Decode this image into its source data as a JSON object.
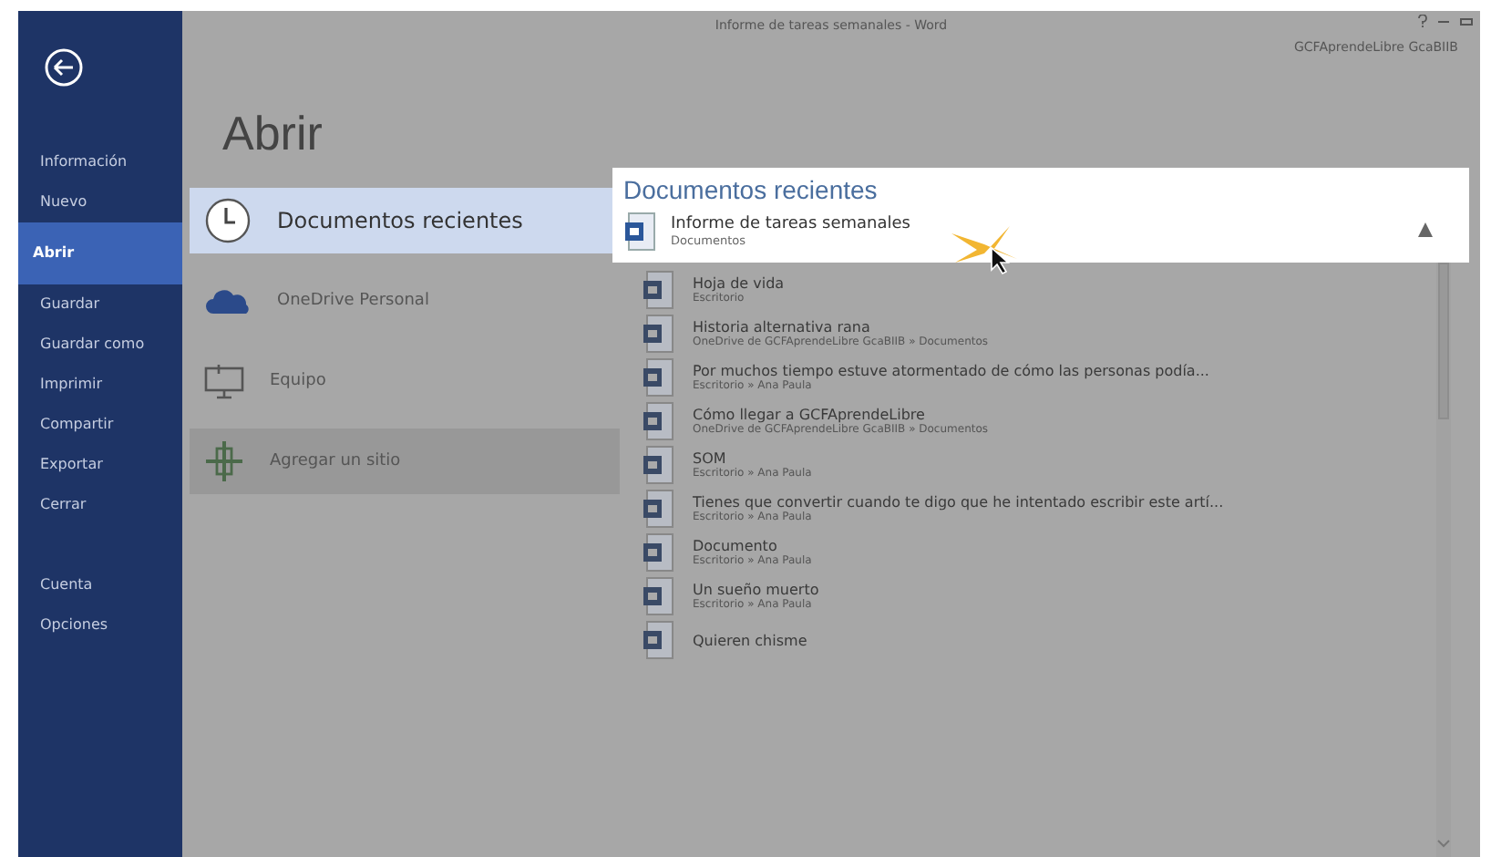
{
  "window": {
    "title": "Informe de tareas semanales - Word",
    "account": "GCFAprendeLibre GcaBIIB"
  },
  "sidebar": {
    "items": [
      {
        "label": "Información",
        "selected": false
      },
      {
        "label": "Nuevo",
        "selected": false
      },
      {
        "label": "Abrir",
        "selected": true
      },
      {
        "label": "Guardar",
        "selected": false
      },
      {
        "label": "Guardar como",
        "selected": false
      },
      {
        "label": "Imprimir",
        "selected": false
      },
      {
        "label": "Compartir",
        "selected": false
      },
      {
        "label": "Exportar",
        "selected": false
      },
      {
        "label": "Cerrar",
        "selected": false
      }
    ],
    "footer_items": [
      {
        "label": "Cuenta",
        "selected": false
      },
      {
        "label": "Opciones",
        "selected": false
      }
    ]
  },
  "page_title": "Abrir",
  "places": [
    {
      "label": "Documentos recientes",
      "kind": "recent",
      "selected": true
    },
    {
      "label": "OneDrive Personal",
      "kind": "cloud",
      "selected": false
    },
    {
      "label": "Equipo",
      "kind": "computer",
      "selected": false
    },
    {
      "label": "Agregar un sitio",
      "kind": "add",
      "selected": false,
      "hovered": true
    }
  ],
  "recent": {
    "heading": "Documentos recientes",
    "highlighted": {
      "name": "Informe de tareas semanales",
      "path": "Documentos"
    },
    "items": [
      {
        "name": "Hoja de vida",
        "path": "Escritorio"
      },
      {
        "name": "Historia alternativa rana",
        "path": "OneDrive de GCFAprendeLibre GcaBIIB » Documentos"
      },
      {
        "name": "Por muchos tiempo estuve atormentado de cómo las personas podía...",
        "path": "Escritorio » Ana Paula"
      },
      {
        "name": "Cómo llegar a GCFAprendeLibre",
        "path": "OneDrive de GCFAprendeLibre GcaBIIB » Documentos"
      },
      {
        "name": "SOM",
        "path": "Escritorio » Ana Paula"
      },
      {
        "name": "Tienes que convertir cuando te digo que he intentado escribir este artí...",
        "path": "Escritorio » Ana Paula"
      },
      {
        "name": "Documento",
        "path": "Escritorio » Ana Paula"
      },
      {
        "name": "Un sueño muerto",
        "path": "Escritorio » Ana Paula"
      },
      {
        "name": "Quieren chisme"
      }
    ]
  }
}
